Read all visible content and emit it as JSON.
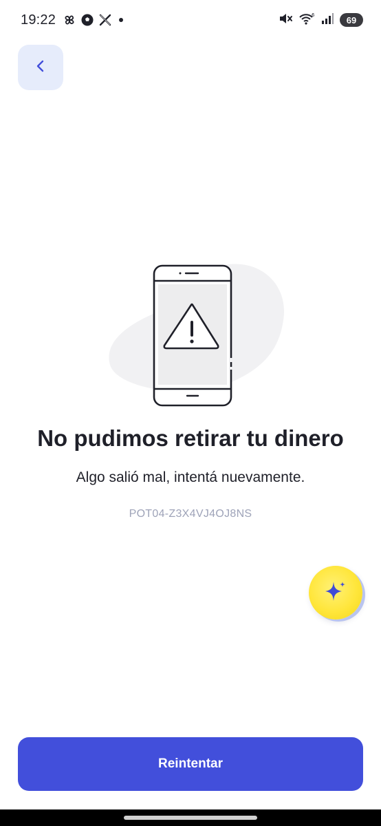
{
  "status_bar": {
    "time": "19:22",
    "left_icons": [
      "pinwheel-icon",
      "soccer-ball-icon",
      "x-logo-icon",
      "dot-icon"
    ],
    "right_icons": [
      "mute-icon",
      "wifi-6-icon",
      "signal-icon"
    ],
    "battery": "69"
  },
  "header": {
    "back_icon": "chevron-left-icon"
  },
  "illustration": {
    "icon": "phone-warning-illustration"
  },
  "content": {
    "title": "No pudimos retirar tu dinero",
    "subtitle": "Algo salió mal, intentá nuevamente.",
    "error_code": "POT04-Z3X4VJ4OJ8NS"
  },
  "assistant": {
    "icon": "sparkle-icon"
  },
  "actions": {
    "retry_label": "Reintentar"
  },
  "colors": {
    "primary": "#424fdb",
    "back_button_bg": "#e6ecfb",
    "assistant_yellow": "#ffe63b",
    "muted_text": "#9ea3b8"
  }
}
